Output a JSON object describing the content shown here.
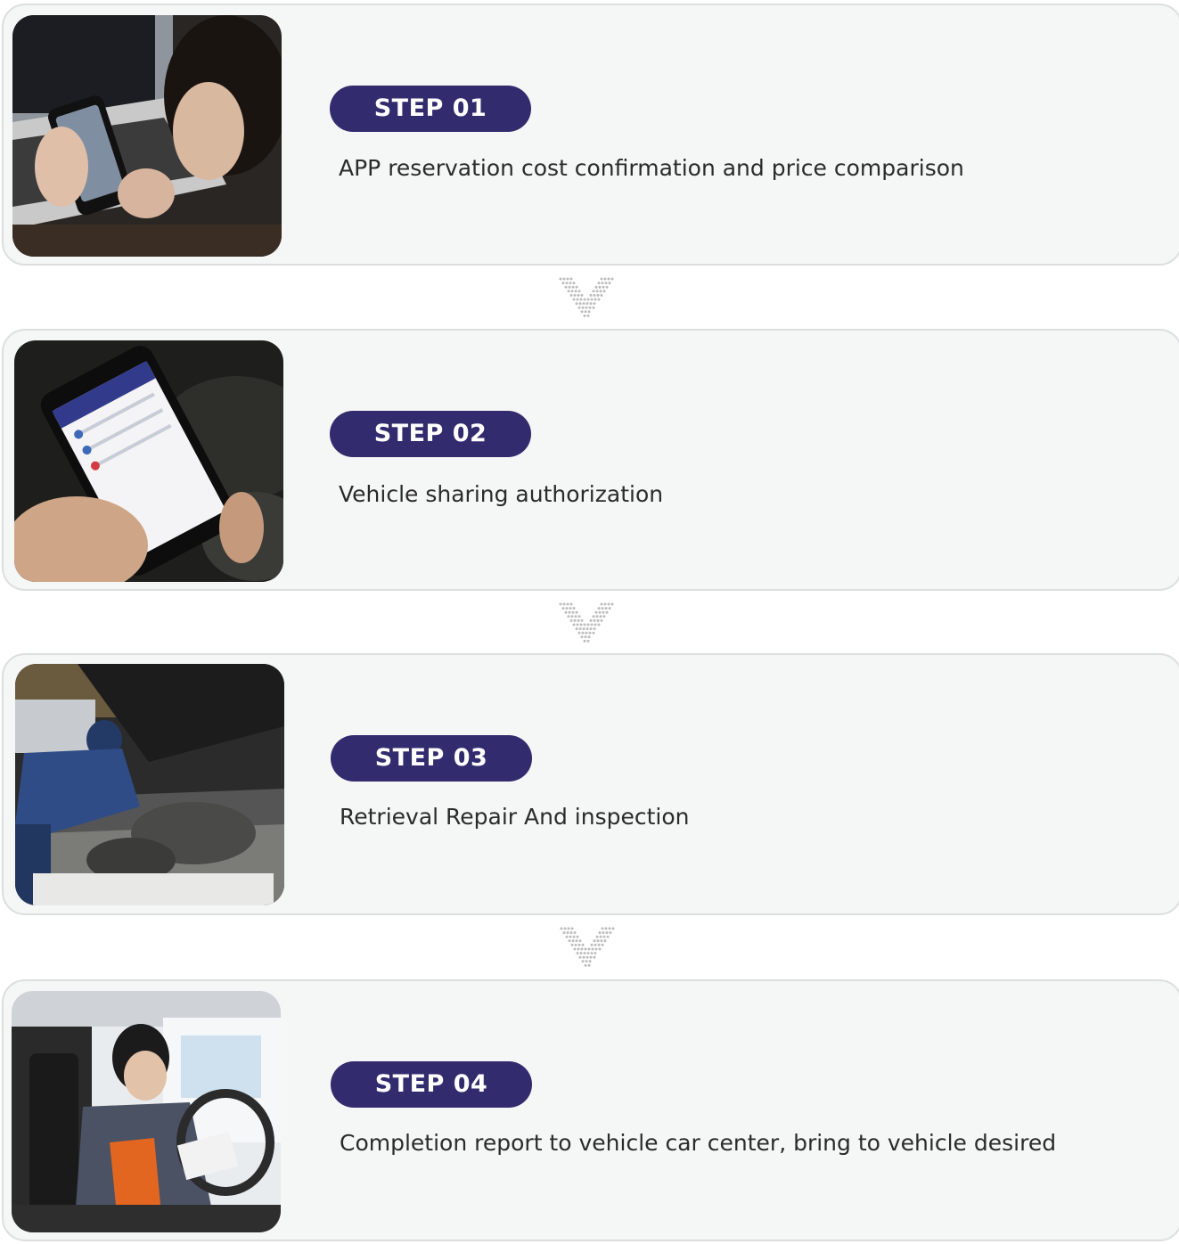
{
  "steps": [
    {
      "badge": "STEP 01",
      "description": "APP reservation cost confirmation and price comparison",
      "photo_icon": "person-using-phone-at-laptop"
    },
    {
      "badge": "STEP 02",
      "description": "Vehicle sharing authorization",
      "photo_icon": "hand-holding-phone-in-car"
    },
    {
      "badge": "STEP 03",
      "description": "Retrieval Repair And inspection",
      "photo_icon": "mechanic-under-car-hood"
    },
    {
      "badge": "STEP 04",
      "description": "Completion report to vehicle car center, bring to vehicle desired",
      "photo_icon": "mechanic-writing-report-in-car"
    }
  ],
  "colors": {
    "badge_background": "#322b6e",
    "badge_text": "#ffffff",
    "card_background": "#f5f6f6",
    "card_border": "#dcdedf",
    "arrow_dots": "#bdbdbd"
  },
  "arrows": [
    {
      "icon": "dotted-chevron-down-icon"
    },
    {
      "icon": "dotted-chevron-down-icon"
    },
    {
      "icon": "dotted-chevron-down-icon"
    }
  ]
}
